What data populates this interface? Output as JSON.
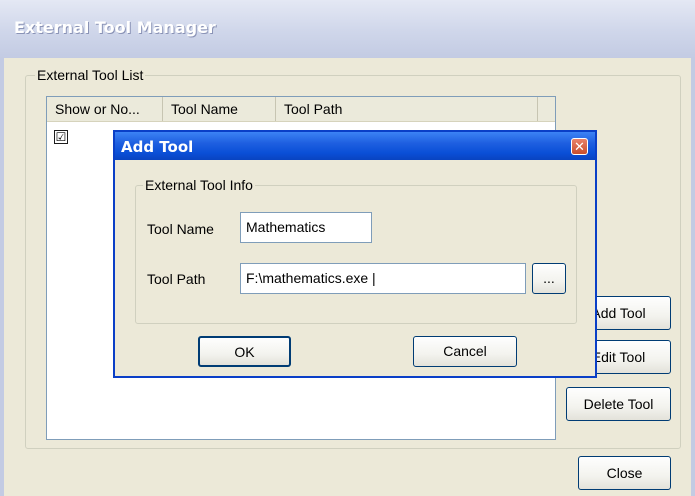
{
  "main_window": {
    "title": "External Tool Manager",
    "group_label": "External Tool List",
    "list": {
      "columns": [
        "Show or No...",
        "Tool Name",
        "Tool Path"
      ],
      "rows": [
        {
          "show_checked": true,
          "check_mark": "☑",
          "tool_name": "",
          "tool_path": ""
        }
      ]
    },
    "buttons": {
      "add": "Add Tool",
      "edit": "Edit Tool",
      "delete": "Delete Tool",
      "close": "Close"
    }
  },
  "dialog": {
    "title": "Add Tool",
    "close_glyph": "✕",
    "group_label": "External Tool Info",
    "fields": {
      "tool_name_label": "Tool Name",
      "tool_name_value": "Mathematics",
      "tool_path_label": "Tool Path",
      "tool_path_value": "F:\\mathematics.exe",
      "browse_label": "..."
    },
    "buttons": {
      "ok": "OK",
      "cancel": "Cancel"
    }
  },
  "colors": {
    "dialog_title_bar": "#0a4fd7",
    "inactive_title_bar": "#cfd6ea",
    "window_background": "#ece9d8"
  }
}
